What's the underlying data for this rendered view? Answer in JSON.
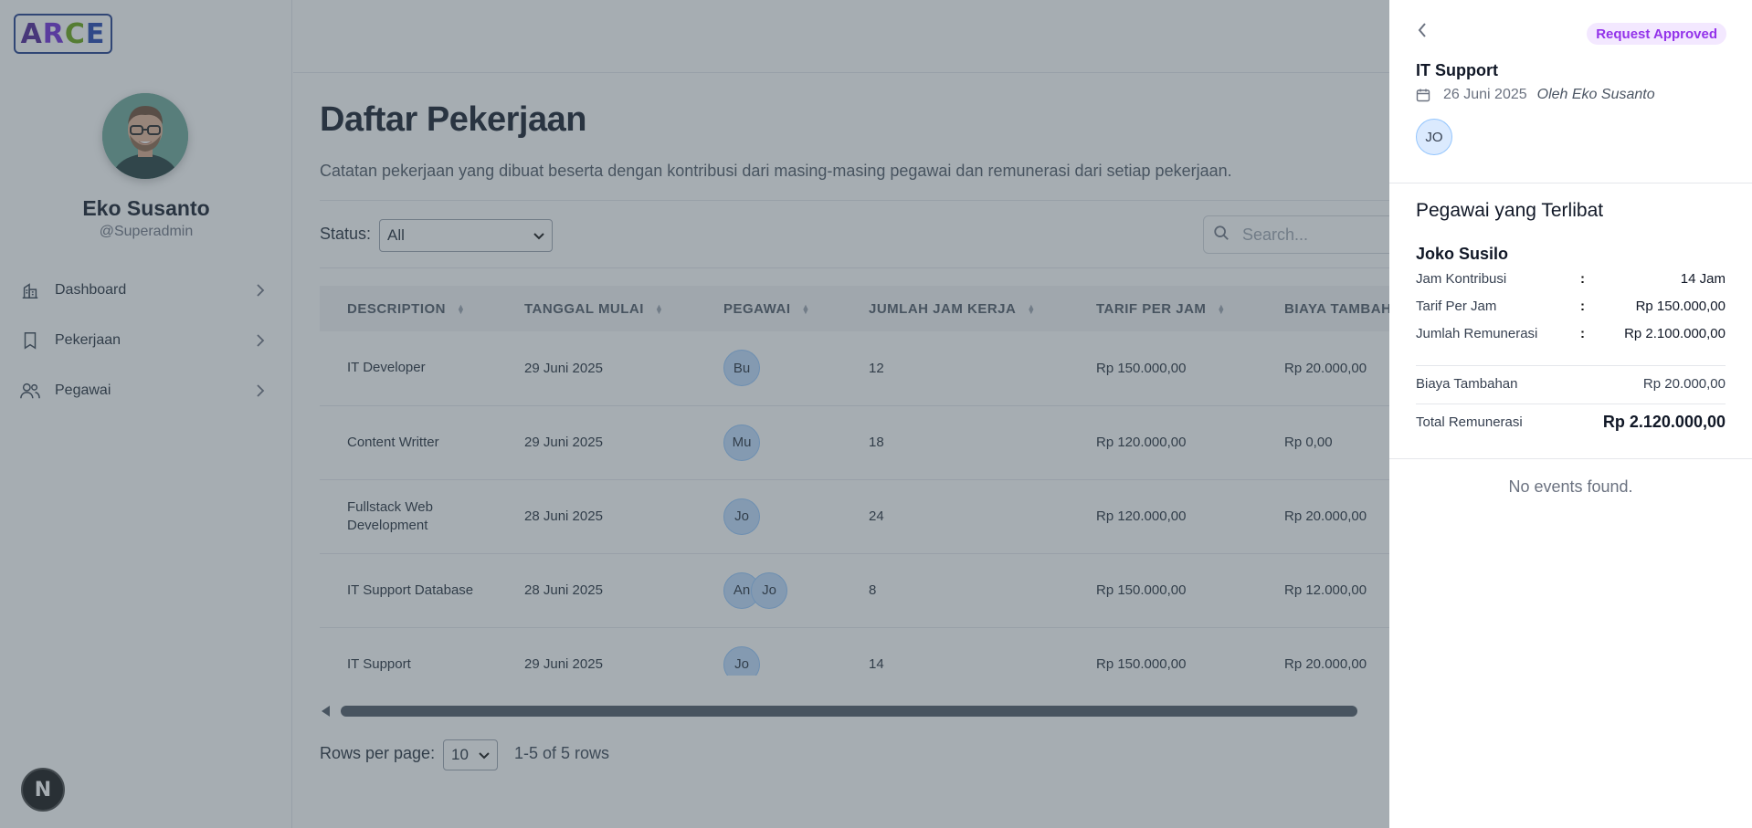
{
  "brand": {
    "logo_letters": [
      {
        "char": "A",
        "color": "#4c1d95"
      },
      {
        "char": "R",
        "color": "#6d28d9"
      },
      {
        "char": "C",
        "color": "#65a30d"
      },
      {
        "char": "E",
        "color": "#1e40af"
      }
    ]
  },
  "profile": {
    "name": "Eko Susanto",
    "handle": "@Superadmin"
  },
  "sidebar": {
    "items": [
      {
        "label": "Dashboard",
        "icon": "building-chart-icon"
      },
      {
        "label": "Pekerjaan",
        "icon": "bookmark-icon"
      },
      {
        "label": "Pegawai",
        "icon": "users-icon"
      }
    ]
  },
  "main": {
    "title": "Daftar Pekerjaan",
    "description": "Catatan pekerjaan yang dibuat beserta dengan kontribusi dari masing-masing pegawai dan remunerasi dari setiap pekerjaan.",
    "status_label": "Status:",
    "status_value": "All",
    "search_placeholder": "Search...",
    "table": {
      "columns": [
        "DESCRIPTION",
        "TANGGAL MULAI",
        "PEGAWAI",
        "JUMLAH JAM KERJA",
        "TARIF PER JAM",
        "BIAYA TAMBAHAN"
      ],
      "rows": [
        {
          "description": "IT Developer",
          "date": "29 Juni 2025",
          "pegawai": [
            "Bu"
          ],
          "hours": "12",
          "rate": "Rp 150.000,00",
          "extra": "Rp 20.000,00"
        },
        {
          "description": "Content Writter",
          "date": "29 Juni 2025",
          "pegawai": [
            "Mu"
          ],
          "hours": "18",
          "rate": "Rp 120.000,00",
          "extra": "Rp 0,00"
        },
        {
          "description": "Fullstack Web Development",
          "date": "28 Juni 2025",
          "pegawai": [
            "Jo"
          ],
          "hours": "24",
          "rate": "Rp 120.000,00",
          "extra": "Rp 20.000,00"
        },
        {
          "description": "IT Support Database",
          "date": "28 Juni 2025",
          "pegawai": [
            "An",
            "Jo"
          ],
          "hours": "8",
          "rate": "Rp 150.000,00",
          "extra": "Rp 12.000,00"
        },
        {
          "description": "IT Support",
          "date": "29 Juni 2025",
          "pegawai": [
            "Jo"
          ],
          "hours": "14",
          "rate": "Rp 150.000,00",
          "extra": "Rp 20.000,00"
        }
      ]
    },
    "pagination": {
      "rows_per_page_label": "Rows per page:",
      "rows_per_page_value": "10",
      "info": "1-5 of 5 rows"
    }
  },
  "drawer": {
    "status_badge": "Request Approved",
    "title": "IT Support",
    "date": "26 Juni 2025",
    "author": "Oleh Eko Susanto",
    "chip": "JO",
    "involved_title": "Pegawai yang Terlibat",
    "employee": {
      "name": "Joko Susilo",
      "rows": [
        {
          "key": "Jam Kontribusi",
          "value": "14 Jam"
        },
        {
          "key": "Tarif Per Jam",
          "value": "Rp 150.000,00"
        },
        {
          "key": "Jumlah Remunerasi",
          "value": "Rp 2.100.000,00"
        }
      ]
    },
    "extra_cost_label": "Biaya Tambahan",
    "extra_cost_value": "Rp 20.000,00",
    "total_label": "Total Remunerasi",
    "total_value": "Rp 2.120.000,00",
    "empty_events": "No events found."
  },
  "colors": {
    "overlay": "#46545e",
    "badge_bg": "#f3e8ff",
    "badge_text": "#9333ea",
    "chip_bg": "#bfdbfe"
  }
}
